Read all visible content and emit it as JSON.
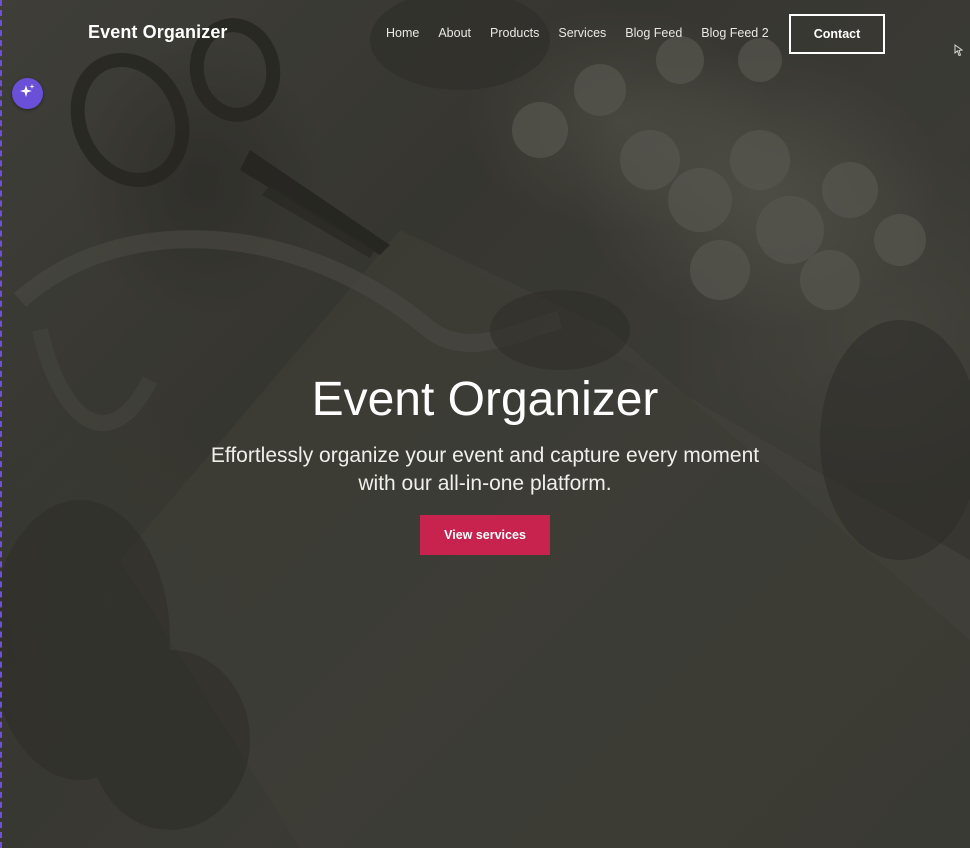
{
  "header": {
    "brand": "Event Organizer",
    "nav": [
      {
        "label": "Home"
      },
      {
        "label": "About"
      },
      {
        "label": "Products"
      },
      {
        "label": "Services"
      },
      {
        "label": "Blog Feed"
      },
      {
        "label": "Blog Feed 2"
      }
    ],
    "contact_label": "Contact"
  },
  "hero": {
    "title": "Event Organizer",
    "subtitle": "Effortlessly organize your event and capture every moment with our all-in-one platform.",
    "cta_label": "View services",
    "background_icon": "flowers-scissors-photo"
  },
  "ai_button": {
    "icon": "sparkle-icon"
  },
  "colors": {
    "accent": "#c8234f",
    "ai_fab": "#6a4fd8",
    "overlay": "#3f3e38"
  }
}
